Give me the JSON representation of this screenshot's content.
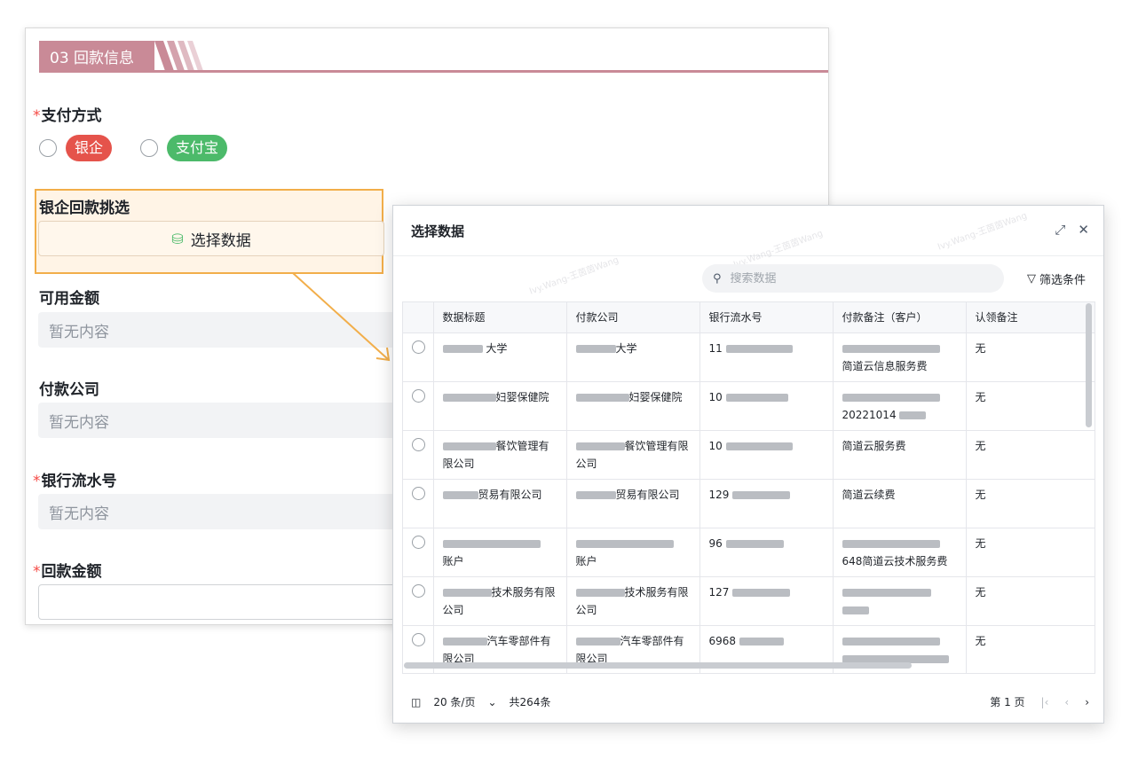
{
  "form": {
    "section_title": "03 回款信息",
    "required_mark": "*",
    "payment_method_label": "支付方式",
    "payment_options": [
      "银企",
      "支付宝"
    ],
    "bank_pick_label": "银企回款挑选",
    "select_data_button": "选择数据",
    "available_amount_label": "可用金额",
    "payer_company_label": "付款公司",
    "bank_serial_label": "银行流水号",
    "refund_amount_label": "回款金额",
    "empty_placeholder": "暂无内容"
  },
  "modal": {
    "title": "选择数据",
    "search_placeholder": "搜索数据",
    "filter_label": "筛选条件",
    "watermark": "Ivy.Wang-王茵茵Wang",
    "columns": [
      "数据标题",
      "付款公司",
      "银行流水号",
      "付款备注（客户）",
      "认领备注"
    ],
    "rows": [
      {
        "title": "大学",
        "company": "大学",
        "serial": "11",
        "remark": "简道云信息服务费",
        "claim": "无"
      },
      {
        "title": "妇婴保健院",
        "company": "妇婴保健院",
        "serial": "10",
        "remark": "20221014",
        "claim": "无"
      },
      {
        "title": "餐饮管理有限公司",
        "company": "餐饮管理有限公司",
        "serial": "10",
        "remark": "简道云服务费",
        "claim": "无"
      },
      {
        "title": "贸易有限公司",
        "company": "贸易有限公司",
        "serial": "129",
        "remark": "简道云续费",
        "claim": "无"
      },
      {
        "title": "账户",
        "company": "账户",
        "serial": "96",
        "remark": "648简道云技术服务费",
        "claim": "无"
      },
      {
        "title": "技术服务有限公司",
        "company": "技术服务有限公司",
        "serial": "127",
        "remark": "",
        "claim": "无"
      },
      {
        "title": "汽车零部件有限公司",
        "company": "汽车零部件有限公司",
        "serial": "6968",
        "remark": "",
        "claim": "无"
      }
    ],
    "pagination": {
      "page_size": "20 条/页",
      "total": "共264条",
      "page": "第 1 页"
    }
  },
  "colors": {
    "section_accent": "#c98a97",
    "pill_red": "#e5534b",
    "pill_green": "#4cba6a",
    "highlight_border": "#f2ae4a",
    "required": "#f54a45"
  }
}
